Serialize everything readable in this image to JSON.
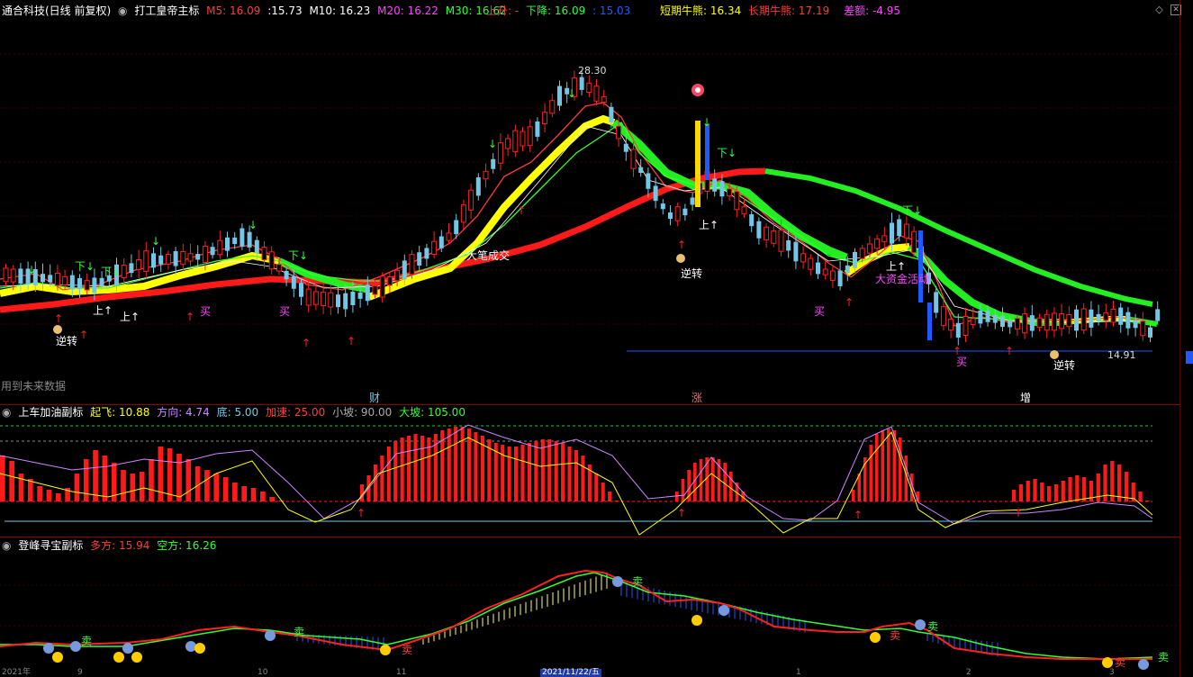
{
  "main_header": {
    "stock": "通合科技(日线 前复权)",
    "indicator": "打工皇帝主标",
    "m5_label": "M5: 16.09",
    "m5b_label": ":15.73",
    "m10_label": "M10: 16.23",
    "m20_label": "M20: 16.22",
    "m30_label": "M30: 16.62",
    "up_label": "上升: -",
    "down_label": "下降: 16.09",
    "down2_label": ": 15.03",
    "short_label": "短期牛熊: 16.34",
    "long_label": "长期牛熊: 17.19",
    "diff_label": "差额: -4.95"
  },
  "colors": {
    "m5": "#ff3b3b",
    "m10": "#ffffff",
    "m20": "#ff44ff",
    "m30": "#33ff33",
    "red": "#ff2020",
    "yellow": "#ffff00",
    "green": "#22dd22",
    "blue": "#1e5aff",
    "cyan": "#74c6e6",
    "magenta": "#ff33cc"
  },
  "main_chart": {
    "high_label": "28.30",
    "low_label": "14.91",
    "future_label": "用到未来数据",
    "big_trade_label": "大笔成交",
    "big_fund_label": "大资金活动",
    "events": [
      "财",
      "涨",
      "增"
    ],
    "signals": {
      "up": "上↑",
      "down": "下↓",
      "buy": "买",
      "reverse": "逆转"
    }
  },
  "sub1_header": {
    "title": "上车加油副标",
    "fly_label": "起飞: 10.88",
    "dir_label": "方向: 4.74",
    "bottom_label": "底: 5.00",
    "acc_label": "加速: 25.00",
    "small_label": "小坡: 90.00",
    "big_label": "大坡: 105.00"
  },
  "sub2_header": {
    "title": "登峰寻宝副标",
    "long_label": "多方: 15.94",
    "short_label": "空方: 16.26",
    "sell_label": "卖"
  },
  "footer": {
    "date_label": "2021/11/22/五",
    "ticks": [
      "2021年",
      "9",
      "10",
      "11",
      "1",
      "2",
      "3"
    ]
  }
}
